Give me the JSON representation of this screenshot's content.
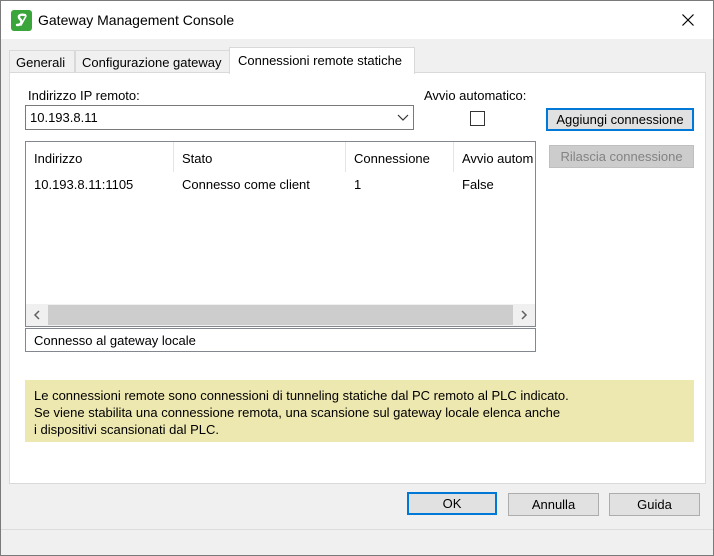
{
  "window": {
    "title": "Gateway Management Console"
  },
  "tabs": [
    {
      "label": "Generali"
    },
    {
      "label": "Configurazione gateway"
    },
    {
      "label": "Connessioni remote statiche"
    }
  ],
  "remote_ip": {
    "label": "Indirizzo IP remoto:",
    "value": "10.193.8.11"
  },
  "auto_start": {
    "label": "Avvio automatico:",
    "checked": false
  },
  "buttons": {
    "add": "Aggiungi connessione",
    "release": "Rilascia connessione",
    "ok": "OK",
    "cancel": "Annulla",
    "help": "Guida"
  },
  "connections_table": {
    "columns": [
      "Indirizzo",
      "Stato",
      "Connessione",
      "Avvio autom"
    ],
    "rows": [
      [
        "10.193.8.11:1105",
        "Connesso come client",
        "1",
        "False"
      ]
    ]
  },
  "status_text": "Connesso al gateway locale",
  "info": {
    "line1": "Le connessioni remote sono connessioni di tunneling statiche dal PC remoto al PLC indicato.",
    "line2": "Se viene stabilita una connessione remota, una scansione sul gateway locale elenca anche",
    "line3": "i dispositivi scansionati dal PLC."
  },
  "colors": {
    "info_background": "#ede7b0",
    "primary_border": "#0078d7",
    "app_icon": "#3aa53a"
  }
}
